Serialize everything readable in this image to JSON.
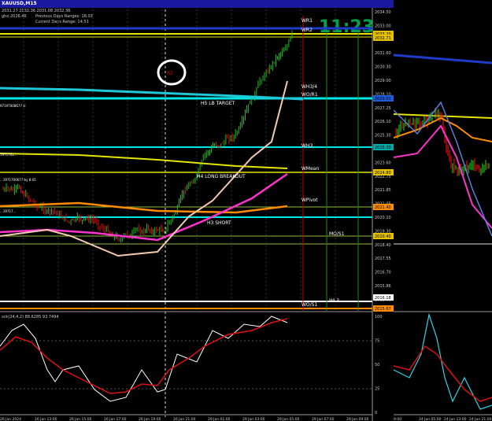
{
  "window": {
    "title": "XAUUSD,M15",
    "ohlc": "2031.27 2032.36 2031.08 2032.36",
    "info_line1": "gho 2026.46",
    "info_line2": "Previous Days Ranges: 18.03",
    "info_line3": "Current Days Range: 14.51",
    "countdown": "11:23"
  },
  "price_labels": [
    "2034.50",
    "2033.00",
    "2032.20",
    "2031.60",
    "2030.30",
    "2029.00",
    "2028.10",
    "2027.25",
    "2026.10",
    "2025.30",
    "2024.55",
    "2023.60",
    "2022.75",
    "2021.85",
    "2021.05",
    "2020.10",
    "2019.30",
    "2018.40",
    "2017.55",
    "2016.70",
    "2015.86",
    "2015.00"
  ],
  "price_boxes": [
    {
      "text": "2033.20",
      "color": "#e5c100"
    },
    {
      "text": "2032.71",
      "color": "#e5c100"
    },
    {
      "text": "2029.01",
      "color": "#1e5bd8"
    },
    {
      "text": "2025.30",
      "color": "#00a8a8"
    },
    {
      "text": "2024.80",
      "color": "#e5c100"
    },
    {
      "text": "2021.40",
      "color": "#ff8c00"
    },
    {
      "text": "2020.40",
      "color": "#e5c100"
    },
    {
      "text": "2016.18",
      "color": "#ffffff"
    },
    {
      "text": "2015.67",
      "color": "#ff8c00"
    }
  ],
  "level_labels": [
    {
      "text": "WR1"
    },
    {
      "text": "WR2"
    },
    {
      "text": "WH3/4"
    },
    {
      "text": "WO/R1"
    },
    {
      "text": "H5 LB TARGET"
    },
    {
      "text": "WH3"
    },
    {
      "text": "WMean"
    },
    {
      "text": "H4 LONG BREAKOUT"
    },
    {
      "text": "WPivot"
    },
    {
      "text": "H3 SHORT"
    },
    {
      "text": "MO/S1"
    },
    {
      "text": "WO/S1"
    },
    {
      "text": "WL3"
    }
  ],
  "annotation": {
    "text": "R2"
  },
  "left_tags": [
    "97197008677 sl",
    "1971702...",
    "...1971700677 by 8.05",
    "...19717..."
  ],
  "oscillator": {
    "label": "sck(24,4,2) 88.6285 93.7494",
    "levels": [
      "100",
      "75",
      "50",
      "25",
      "0"
    ]
  },
  "time_labels": [
    "26 Jan 2024",
    "26 Jan 13:00",
    "26 Jan 15:00",
    "26 Jan 17:00",
    "26 Jan 19:00",
    "26 Jan 21:00",
    "29 Jan 01:00",
    "29 Jan 03:00",
    "29 Jan 05:00",
    "29 Jan 07:00",
    "29 Jan 09:00"
  ],
  "side_time_labels": [
    "9:00",
    "24 Jan 05:00",
    "24 Jan 13:00",
    "24 Jan 21:00"
  ],
  "colors": {
    "background": "#000000",
    "bull": "#22bb22",
    "bear": "#dd1111",
    "yellow": "#e5e500",
    "cyan": "#00e5e5",
    "magenta": "#ff33cc",
    "orange": "#ff8c00",
    "blue": "#1e3cc8"
  }
}
